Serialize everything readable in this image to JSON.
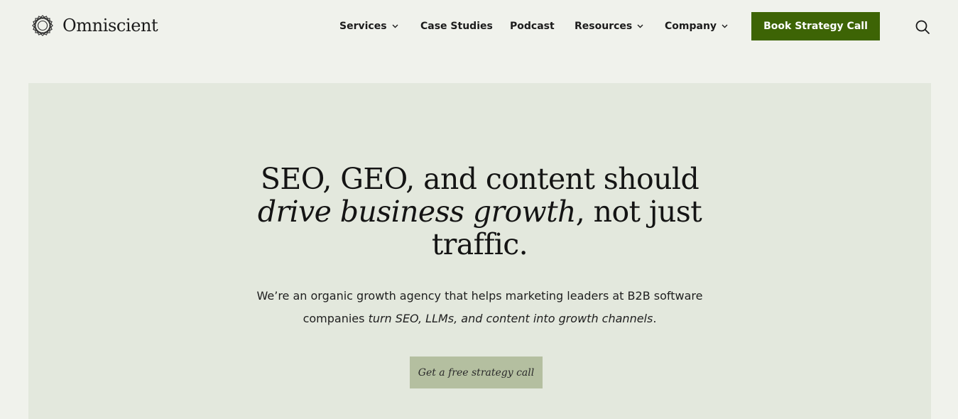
{
  "brand": {
    "name": "Omniscient",
    "logo_icon": "interlocking-knot-logo"
  },
  "nav": {
    "items": [
      {
        "label": "Services",
        "has_dropdown": true
      },
      {
        "label": "Case Studies",
        "has_dropdown": false
      },
      {
        "label": "Podcast",
        "has_dropdown": false
      },
      {
        "label": "Resources",
        "has_dropdown": true
      },
      {
        "label": "Company",
        "has_dropdown": true
      }
    ],
    "cta_label": "Book Strategy Call",
    "search_icon": "search-icon"
  },
  "hero": {
    "title_line1": "SEO, GEO, and content should",
    "title_line2_italic": "drive business growth",
    "title_line2_rest": ", not just",
    "title_line3": "traffic.",
    "subtitle_line1": "We’re an organic growth agency that helps marketing leaders at B2B software",
    "subtitle_line2_start": "companies ",
    "subtitle_line2_italic": "turn SEO, LLMs, and content into growth channels",
    "subtitle_line2_end": ".",
    "cta_label": "Get a free strategy call"
  },
  "colors": {
    "page_background": "#f0f2ec",
    "hero_background": "#e3e8dd",
    "primary_green": "#3d6405",
    "secondary_button": "#b4bfa0",
    "text": "#141414"
  }
}
